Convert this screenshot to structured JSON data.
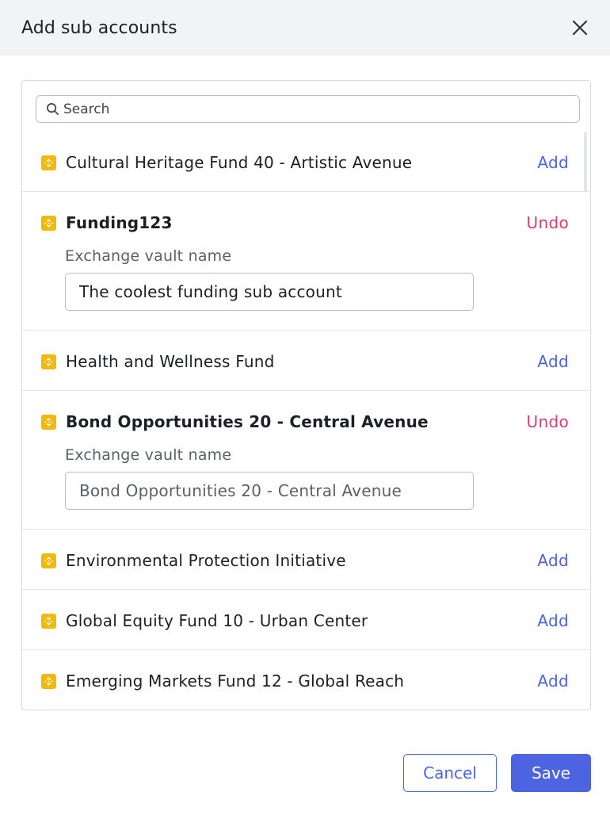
{
  "dialog": {
    "title": "Add sub accounts",
    "close_icon": "close-icon"
  },
  "search": {
    "placeholder": "Search",
    "value": ""
  },
  "accounts": [
    {
      "name": "Cultural Heritage Fund 40 - Artistic Avenue",
      "action": "Add",
      "state": "collapsed"
    },
    {
      "name": "Funding123",
      "action": "Undo",
      "state": "expanded",
      "vault_label": "Exchange vault name",
      "vault_value": "The coolest funding sub account",
      "vault_placeholder": ""
    },
    {
      "name": "Health and Wellness Fund",
      "action": "Add",
      "state": "collapsed"
    },
    {
      "name": "Bond Opportunities 20 - Central Avenue",
      "action": "Undo",
      "state": "expanded",
      "vault_label": "Exchange vault name",
      "vault_value": "",
      "vault_placeholder": "Bond Opportunities 20 - Central Avenue"
    },
    {
      "name": "Environmental Protection Initiative",
      "action": "Add",
      "state": "collapsed"
    },
    {
      "name": "Global Equity Fund 10 - Urban Center",
      "action": "Add",
      "state": "collapsed"
    },
    {
      "name": "Emerging Markets Fund 12 - Global Reach",
      "action": "Add",
      "state": "collapsed"
    }
  ],
  "footer": {
    "cancel_label": "Cancel",
    "save_label": "Save"
  },
  "colors": {
    "accent": "#4d64e0",
    "undo": "#d3416d",
    "coin": "#f0b90b",
    "header_bg": "#f2f3f5"
  }
}
